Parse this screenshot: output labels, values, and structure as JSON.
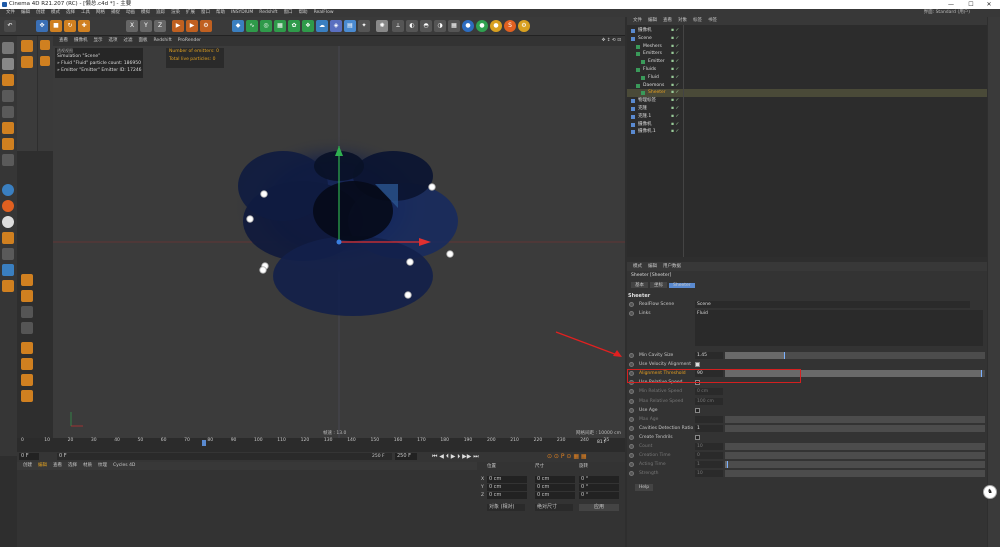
{
  "window": {
    "title": "Cinema 4D R21.207 (RC) - [懒总.c4d *] - 主要",
    "minimize": "—",
    "maximize": "☐",
    "close": "✕"
  },
  "menubar": {
    "items": [
      "文件",
      "编辑",
      "创建",
      "模式",
      "选择",
      "工具",
      "网格",
      "捕捉",
      "动画",
      "模拟",
      "追踪",
      "渲染",
      "扩展",
      "窗口",
      "帮助",
      "INSYDIUM",
      "Redshift",
      "窗口",
      "帮助",
      "RealFlow"
    ],
    "right_label": "界面: Standard (用户)"
  },
  "toolbar": {
    "undo": "↶",
    "move": "✥",
    "x_label": "X",
    "y_label": "Y",
    "z_label": "Z"
  },
  "viewport": {
    "menu": [
      "查看",
      "摄像机",
      "显示",
      "选项",
      "过滤",
      "面板",
      "Redshift",
      "ProRender"
    ],
    "info_title": "Simulation \"Scene\"",
    "info_line1": "» Fluid \"Fluid\" particle count: 186950",
    "info_line2": "» Emitter \"Emitter\" Emitter ID: 17246",
    "num_emitters": "Number of emitters: 0",
    "total_particles": "Total live particles: 0",
    "speed": "帧速 : 13.0",
    "grid_spacing": "网格间距 : 10000 cm",
    "view_label": "透视视图"
  },
  "timeline": {
    "ticks": [
      "0",
      "10",
      "20",
      "30",
      "40",
      "50",
      "60",
      "70",
      "80",
      "90",
      "100",
      "110",
      "120",
      "130",
      "140",
      "150",
      "160",
      "170",
      "180",
      "190",
      "200",
      "210",
      "220",
      "230",
      "240",
      "25"
    ],
    "current_frame": "81 F",
    "start": "0 F",
    "start2": "0 F",
    "end": "250 F",
    "end2": "250 F"
  },
  "bottom": {
    "tabs": [
      "创建",
      "编辑",
      "查看",
      "选择",
      "材质",
      "纹理",
      "Cycles 4D"
    ],
    "coord_headers": [
      "位置",
      "尺寸",
      "旋转"
    ],
    "x_pos": "0 cm",
    "y_pos": "0 cm",
    "z_pos": "0 cm",
    "x_size": "0 cm",
    "y_size": "0 cm",
    "z_size": "0 cm",
    "h_rot": "0 °",
    "p_rot": "0 °",
    "b_rot": "0 °",
    "mode_select": "对象 (相对)",
    "size_select": "绝对尺寸",
    "apply": "应用"
  },
  "objects": {
    "menu": [
      "文件",
      "编辑",
      "查看",
      "对象",
      "标签",
      "书签"
    ],
    "rows": [
      {
        "name": "摄像机",
        "indent": 0
      },
      {
        "name": "Scene",
        "indent": 0
      },
      {
        "name": "Meshers",
        "indent": 1
      },
      {
        "name": "Emitters",
        "indent": 1
      },
      {
        "name": "Emitter",
        "indent": 2
      },
      {
        "name": "Fluids",
        "indent": 1
      },
      {
        "name": "Fluid",
        "indent": 2
      },
      {
        "name": "Daemons",
        "indent": 1
      },
      {
        "name": "Sheeter",
        "indent": 2
      },
      {
        "name": "物理标签",
        "indent": 0
      },
      {
        "name": "克隆",
        "indent": 0
      },
      {
        "name": "克隆.1",
        "indent": 0
      },
      {
        "name": "摄像机",
        "indent": 0
      },
      {
        "name": "摄像机.1",
        "indent": 0
      }
    ]
  },
  "attributes": {
    "menu": [
      "模式",
      "编辑",
      "用户数据"
    ],
    "object_title": "Sheeter [Sheeter]",
    "tabs": [
      "基本",
      "坐标",
      "Sheeter"
    ],
    "section": "Sheeter",
    "realflow_scene_label": "RealFlow Scene",
    "realflow_scene_value": "Scene",
    "links_label": "Links",
    "links_value": "Fluid",
    "rows": [
      {
        "label": "Min Cavity Size",
        "value": "1.45",
        "type": "slider",
        "fill": 0.23
      },
      {
        "label": "Use Velocity Alignment",
        "type": "check",
        "checked": true
      },
      {
        "label": "Alignment Threshold",
        "value": "90",
        "type": "slider",
        "fill": 0.99,
        "highlight": true
      },
      {
        "label": "Use Relative Speed",
        "type": "check",
        "checked": false
      },
      {
        "label": "Min Relative Speed",
        "value": "0 cm",
        "type": "field",
        "dim": true
      },
      {
        "label": "Max Relative Speed",
        "value": "100 cm",
        "type": "field",
        "dim": true
      },
      {
        "label": "Use Age",
        "type": "check",
        "checked": false
      },
      {
        "label": "Max Age",
        "value": "",
        "type": "slider",
        "fill": 0,
        "dim": true
      },
      {
        "label": "Cavities Detection Ratio",
        "value": "1",
        "type": "slider",
        "fill": 0
      },
      {
        "label": "Create Tendrils",
        "type": "check",
        "checked": false
      },
      {
        "label": "Count",
        "value": "10",
        "type": "slider",
        "fill": 0,
        "dim": true
      },
      {
        "label": "Creation Time",
        "value": "0",
        "type": "slider",
        "fill": 0,
        "dim": true
      },
      {
        "label": "Acting Time",
        "value": "1",
        "type": "slider",
        "fill": 0.01,
        "dim": true
      },
      {
        "label": "Strength",
        "value": "10",
        "type": "slider",
        "fill": 0,
        "dim": true
      }
    ],
    "help": "Help"
  },
  "colors": {
    "accent": "#e8a020",
    "highlight_box": "#d42020",
    "arrow": "#e02020"
  }
}
